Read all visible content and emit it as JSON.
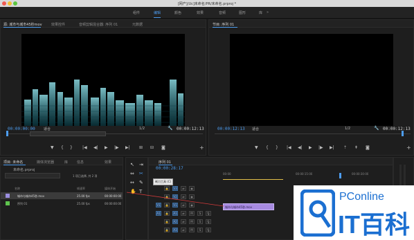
{
  "window": {
    "title": "[网产]/Uc]未命名/PR/未命名.prproj *"
  },
  "workspace_tabs": [
    "组件",
    "编辑",
    "颜色",
    "效果",
    "音频",
    "图形",
    "库"
  ],
  "source_monitor": {
    "tabs": [
      "源: 城市与城市45秒mov",
      "效果控件",
      "音频剪辑混合器: 序列 01",
      "元数据"
    ],
    "timecode_left": "00:00:00:00",
    "fit": "适合",
    "resolution": "1/2",
    "timecode_right": "00:00:12:13"
  },
  "program_monitor": {
    "tab": "节目: 序列 01",
    "timecode_left": "00:00:12:13",
    "fit": "适合",
    "resolution": "1/2",
    "timecode_right": "00:00:12:13"
  },
  "project": {
    "tabs": [
      "项目: 未命名",
      "媒体浏览器",
      "库",
      "信息",
      "效果"
    ],
    "name": "未命名.prproj",
    "selection_info": "1 项已选择, 共 2 项",
    "columns": [
      "名称",
      "帧速率",
      "媒体开始"
    ],
    "items": [
      {
        "name": "城市与城市45秒.mov",
        "fps": "25.00 fps",
        "start": "00:00:00:00"
      },
      {
        "name": "序列 01",
        "fps": "25.00 fps",
        "start": "00:00:00:00"
      }
    ]
  },
  "timeline": {
    "tab": "序列 01",
    "timecode": "00:00:28:17",
    "tooltip": "剃刀工具 (C)",
    "ruler_labels": [
      "00:00",
      "00:00:15:00",
      "00:00:30:00"
    ],
    "tracks": [
      "V3",
      "V2",
      "V1",
      "A1",
      "A2",
      "A3"
    ],
    "clip_label": "城市与城市45秒.mov"
  },
  "watermark": {
    "text1": "PConline",
    "text2": "IT百科"
  },
  "colors": {
    "accent": "#4d9df0",
    "clip": "#a78ae0",
    "tracks_active": "#2c4a6c"
  }
}
